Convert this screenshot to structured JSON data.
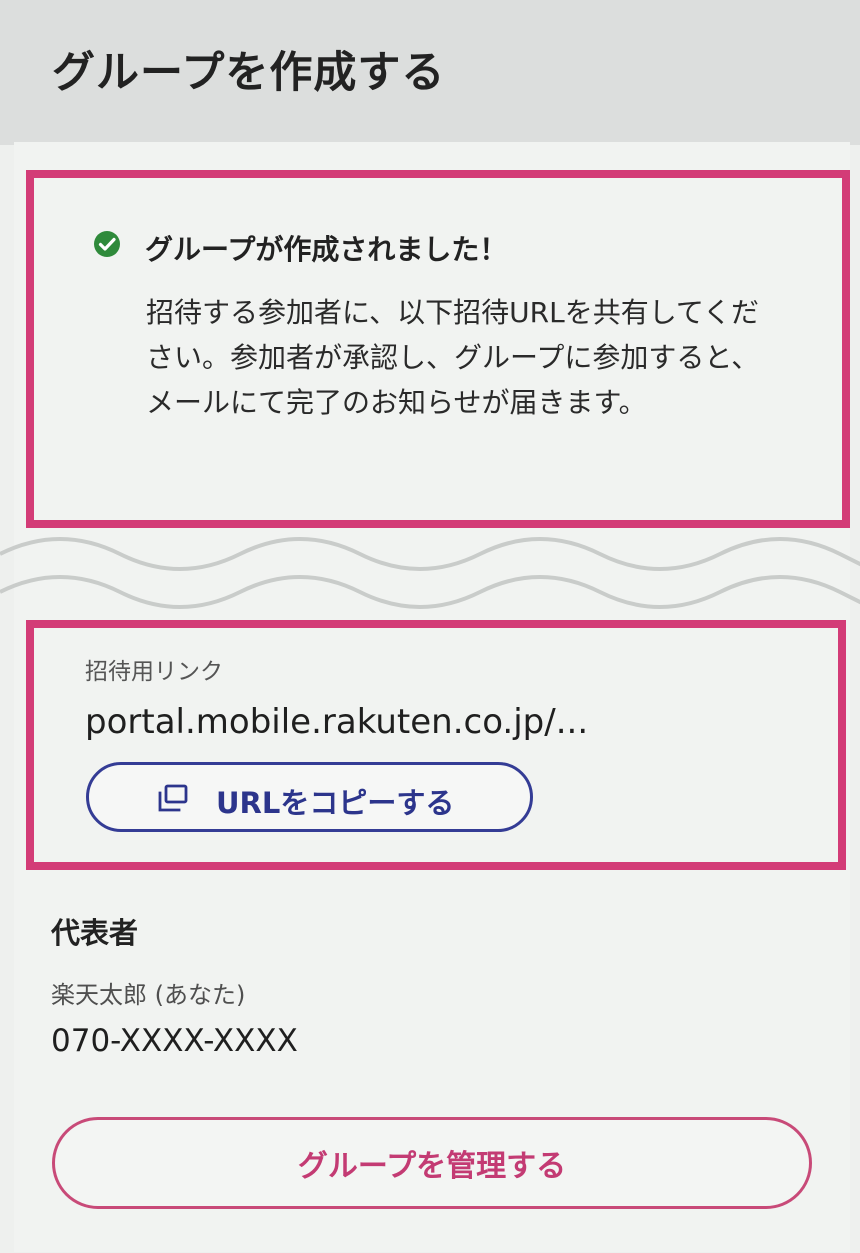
{
  "header": {
    "title": "グループを作成する"
  },
  "success": {
    "title": "グループが作成されました！",
    "message": "招待する参加者に、以下招待URLを共有してください。参加者が承認し、グループに参加すると、メールにて完了のお知らせが届きます。",
    "icon": "check-circle-icon",
    "icon_color": "#2f8a3b"
  },
  "invite": {
    "label": "招待用リンク",
    "url": "portal.mobile.rakuten.co.jp/...",
    "copy_button": "URLをコピーする",
    "copy_icon": "copy-icon"
  },
  "representative": {
    "heading": "代表者",
    "name": "楽天太郎 (あなた)",
    "phone": "070-XXXX-XXXX"
  },
  "actions": {
    "manage_button": "グループを管理する"
  },
  "colors": {
    "highlight": "#d33c77",
    "primary_button": "#343c95",
    "manage_button": "#c33b73"
  }
}
